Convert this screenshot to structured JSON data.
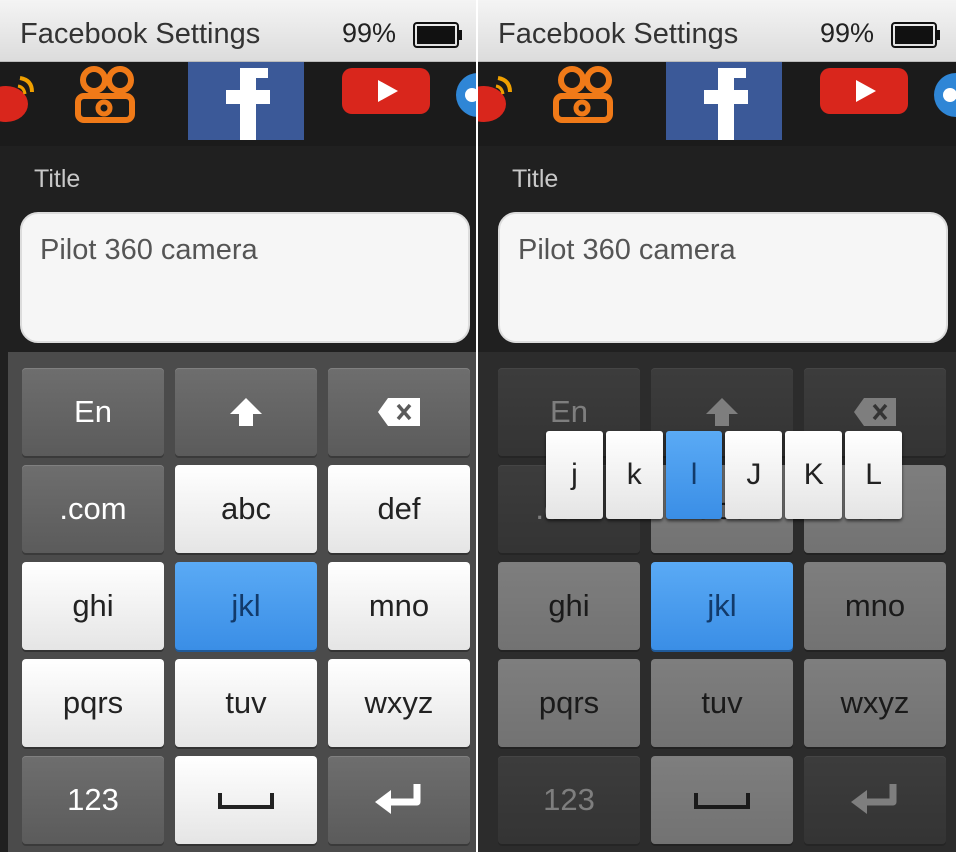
{
  "status_bar": {
    "title": "Facebook Settings",
    "battery_percent": "99%",
    "battery_icon": "battery-full-icon"
  },
  "app_strip": {
    "icons": [
      "weibo-icon",
      "video-app-icon",
      "facebook-icon",
      "youtube-icon",
      "app-icon"
    ]
  },
  "form": {
    "label": "Title",
    "value": "Pilot 360 camera"
  },
  "keyboard": {
    "rows": [
      [
        "En",
        "shift-icon",
        "backspace-icon"
      ],
      [
        ".com",
        "abc",
        "def"
      ],
      [
        "ghi",
        "jkl",
        "mno"
      ],
      [
        "pqrs",
        "tuv",
        "wxyz"
      ],
      [
        "123",
        "space-icon",
        "enter-icon"
      ]
    ],
    "keys": {
      "en": "En",
      "com": ".com",
      "abc": "abc",
      "def": "def",
      "ghi": "ghi",
      "jkl": "jkl",
      "mno": "mno",
      "pqrs": "pqrs",
      "tuv": "tuv",
      "wxyz": "wxyz",
      "num": "123"
    },
    "active_key": "jkl",
    "popup": [
      "j",
      "k",
      "l",
      "J",
      "K",
      "L"
    ],
    "popup_selected": "l"
  },
  "colors": {
    "accent": "#3a8ee6",
    "background": "#202020",
    "key_light": "#f2f2f2",
    "key_dark": "#5b5b5b"
  }
}
